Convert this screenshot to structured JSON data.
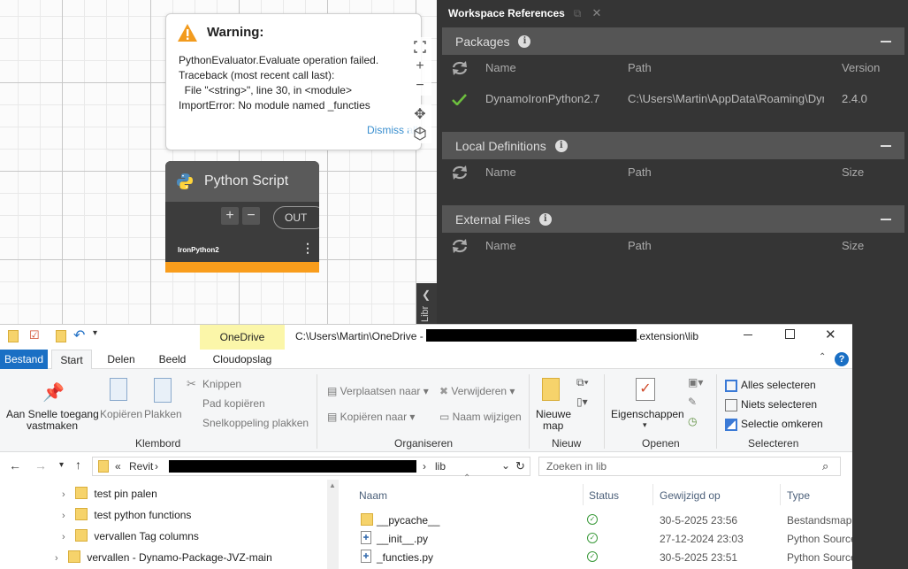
{
  "warning": {
    "title": "Warning:",
    "lines": [
      "PythonEvaluator.Evaluate operation failed.",
      "Traceback (most recent call last):",
      "  File \"<string>\", line 30, in <module>",
      "ImportError: No module named _functies"
    ],
    "dismiss": "Dismiss all"
  },
  "python_node": {
    "title": "Python Script",
    "add": "+",
    "remove": "−",
    "out_port": "OUT",
    "engine": "IronPython2",
    "menu": "⋮"
  },
  "library_tab": "Library",
  "workspace_refs": {
    "title": "Workspace References",
    "packages": {
      "title": "Packages",
      "columns": [
        "Name",
        "Path",
        "Version"
      ],
      "rows": [
        {
          "name": "DynamoIronPython2.7",
          "path": "C:\\Users\\Martin\\AppData\\Roaming\\Dynamo",
          "version": "2.4.0"
        }
      ]
    },
    "local_definitions": {
      "title": "Local Definitions",
      "columns": [
        "Name",
        "Path",
        "Size"
      ]
    },
    "external_files": {
      "title": "External Files",
      "columns": [
        "Name",
        "Path",
        "Size"
      ]
    },
    "colors": {
      "panel": "#353535",
      "section": "#555555",
      "ok": "#6dbf3e"
    }
  },
  "explorer": {
    "onedrive_tab": "OneDrive",
    "path_prefix": "C:\\Users\\Martin\\OneDrive -",
    "path_suffix": ".extension\\lib",
    "tabs": [
      "Bestand",
      "Start",
      "Delen",
      "Beeld",
      "Cloudopslag"
    ],
    "ribbon": {
      "pin_label_1": "Aan Snelle toegang",
      "pin_label_2": "vastmaken",
      "copy": "Kopiëren",
      "paste": "Plakken",
      "cut": "Knippen",
      "copy_path": "Pad kopiëren",
      "paste_shortcut": "Snelkoppeling plakken",
      "group_clipboard": "Klembord",
      "move_to": "Verplaatsen naar",
      "copy_to": "Kopiëren naar",
      "delete": "Verwijderen",
      "rename": "Naam wijzigen",
      "group_organize": "Organiseren",
      "new_folder_1": "Nieuwe",
      "new_folder_2": "map",
      "group_new": "Nieuw",
      "properties": "Eigenschappen",
      "group_open": "Openen",
      "select_all": "Alles selecteren",
      "select_none": "Niets selecteren",
      "invert_selection": "Selectie omkeren",
      "group_select": "Selecteren"
    },
    "breadcrumb": {
      "chevrons": "«",
      "first": "Revit",
      "last": "lib"
    },
    "search_placeholder": "Zoeken in lib",
    "nav_items": [
      "test pin palen",
      "test python functions",
      "vervallen Tag columns",
      "vervallen - Dynamo-Package-JVZ-main"
    ],
    "columns": [
      "Naam",
      "Status",
      "Gewijzigd op",
      "Type"
    ],
    "files": [
      {
        "name": "__pycache__",
        "status": "synced",
        "modified": "30-5-2025 23:56",
        "type": "Bestandsmap"
      },
      {
        "name": "__init__.py",
        "status": "synced",
        "modified": "27-12-2024 23:03",
        "type": "Python Source"
      },
      {
        "name": "_functies.py",
        "status": "synced",
        "modified": "30-5-2025 23:51",
        "type": "Python Source"
      }
    ]
  }
}
